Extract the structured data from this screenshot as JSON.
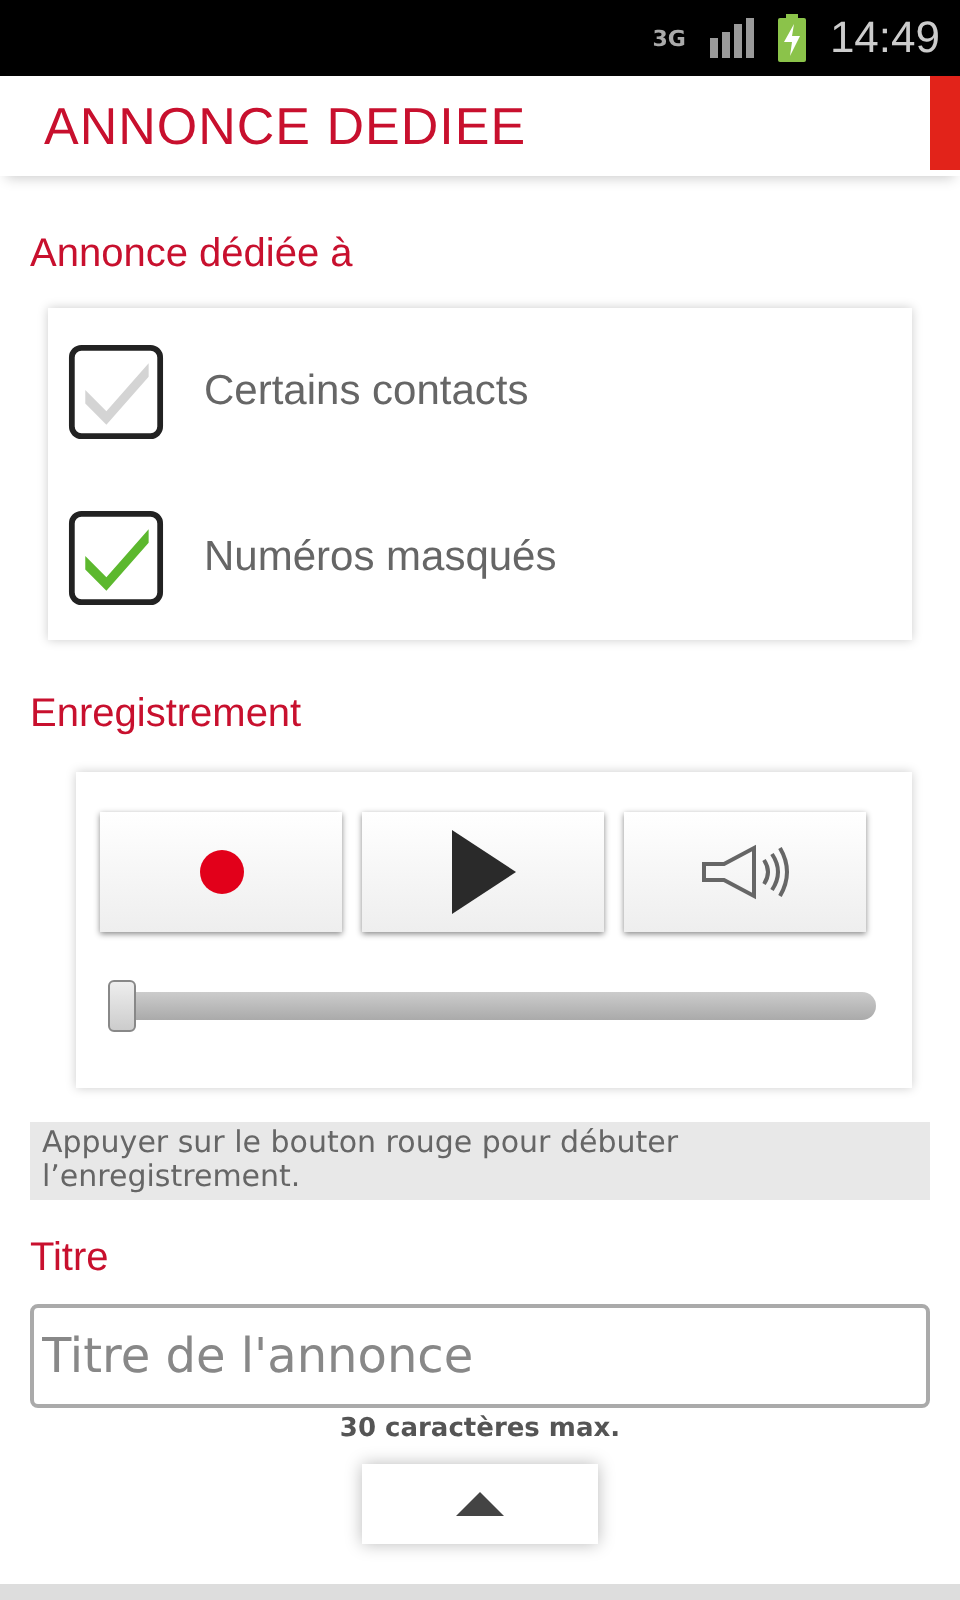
{
  "status_bar": {
    "network": "3G",
    "time": "14:49"
  },
  "header": {
    "title": "ANNONCE DEDIEE"
  },
  "dedicated_to": {
    "label": "Annonce dédiée à",
    "options": [
      {
        "label": "Certains contacts",
        "checked": false
      },
      {
        "label": "Numéros masqués",
        "checked": true
      }
    ]
  },
  "recording": {
    "label": "Enregistrement",
    "controls": [
      {
        "kind": "record"
      },
      {
        "kind": "play"
      },
      {
        "kind": "volume"
      }
    ],
    "progress": {
      "level": 0
    },
    "hint": "Appuyer sur le bouton rouge pour débuter l’enregistrement."
  },
  "title_field": {
    "label": "Titre",
    "placeholder": "Titre de l'annonce",
    "note": "30 caractères max."
  },
  "collapse_button": {
    "kind": "up"
  }
}
